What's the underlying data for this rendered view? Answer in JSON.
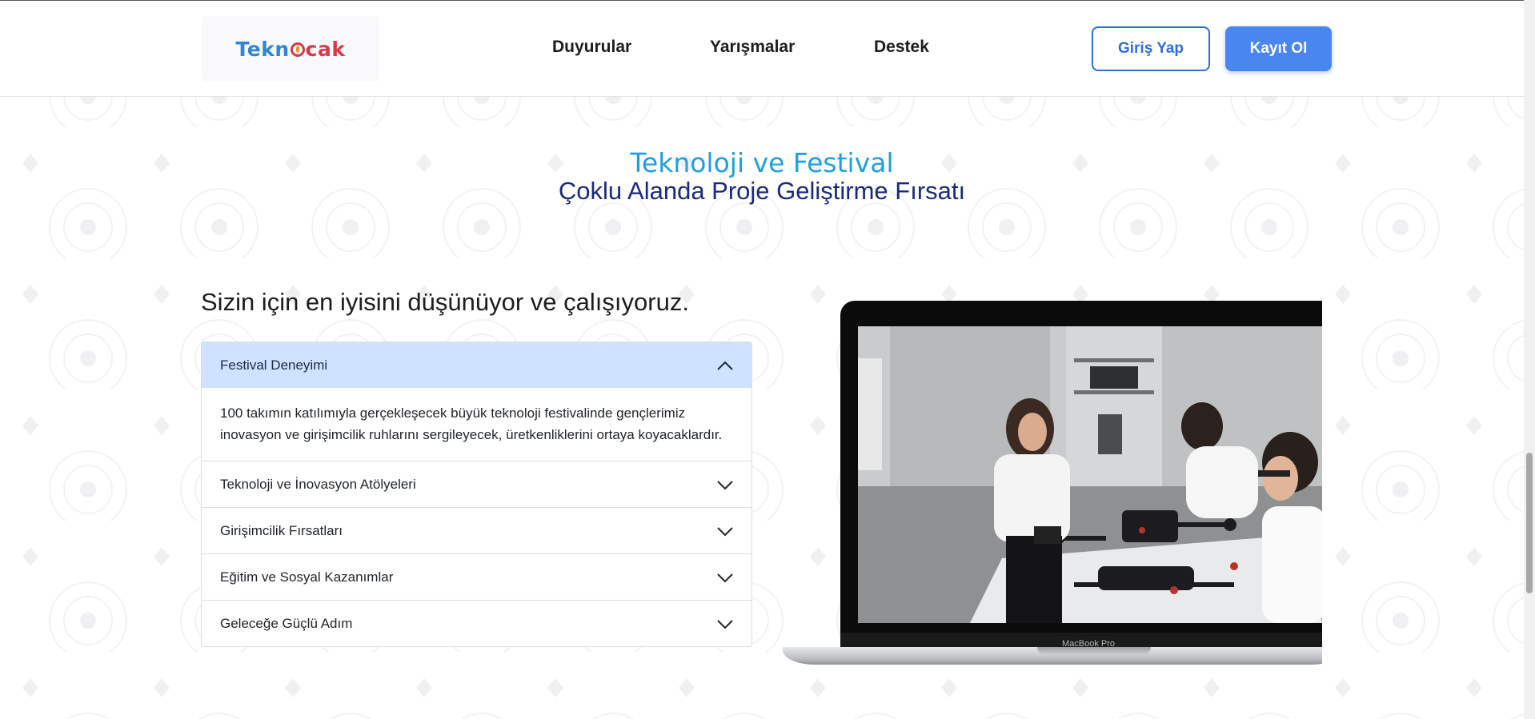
{
  "header": {
    "logo_text": "Tekn",
    "logo_text_end": "cak",
    "nav": [
      "Duyurular",
      "Yarışmalar",
      "Destek"
    ],
    "login_label": "Giriş Yap",
    "register_label": "Kayıt Ol"
  },
  "hero": {
    "title": "Teknoloji ve Festival",
    "subtitle": "Çoklu Alanda Proje Geliştirme Fırsatı"
  },
  "section": {
    "headline": "Sizin için en iyisini düşünüyor ve çalışıyoruz.",
    "accordion": [
      {
        "title": "Festival Deneyimi",
        "expanded": true,
        "body": "100 takımın katılımıyla gerçekleşecek büyük teknoloji festivalinde gençlerimiz inovasyon ve girişimcilik ruhlarını sergileyecek, üretkenliklerini ortaya koyacaklardır."
      },
      {
        "title": "Teknoloji ve İnovasyon Atölyeleri",
        "expanded": false
      },
      {
        "title": "Girişimcilik Fırsatları",
        "expanded": false
      },
      {
        "title": "Eğitim ve Sosyal Kazanımlar",
        "expanded": false
      },
      {
        "title": "Geleceğe Güçlü Adım",
        "expanded": false
      }
    ]
  },
  "laptop": {
    "label": "MacBook Pro"
  },
  "colors": {
    "accent_blue": "#4a86f0",
    "title_cyan": "#1ea0e0",
    "subtitle_navy": "#1b2a7a",
    "accordion_open_bg": "#cfe2ff"
  }
}
